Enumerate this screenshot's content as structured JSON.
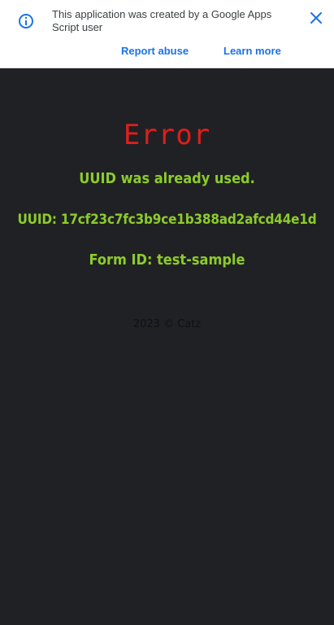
{
  "banner": {
    "message": "This application was created by a Google Apps Script user",
    "report_abuse": "Report abuse",
    "learn_more": "Learn more",
    "info_icon": "info-icon",
    "close_icon": "close-icon"
  },
  "main": {
    "title": "Error",
    "message": "UUID was already used.",
    "uuid": "UUID: 17cf23c7fc3b9ce1b388ad2afcd44e1d",
    "form_id": "Form ID: test-sample",
    "footer": "2023 © Catz"
  },
  "colors": {
    "banner_bg": "#ffffff",
    "link": "#1a73e8",
    "page_bg": "#202124",
    "error_title": "#e11d1d",
    "message_text": "#8ccb2b",
    "footer_text": "#111111"
  }
}
